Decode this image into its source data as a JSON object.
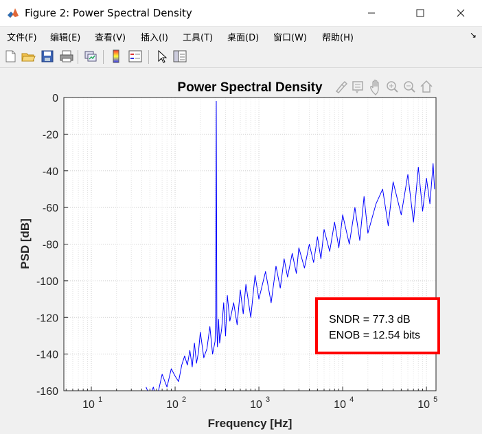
{
  "window": {
    "title": "Figure 2: Power Spectral Density"
  },
  "menu": {
    "items": [
      "文件(F)",
      "编辑(E)",
      "查看(V)",
      "插入(I)",
      "工具(T)",
      "桌面(D)",
      "窗口(W)",
      "帮助(H)"
    ]
  },
  "toolbar": {
    "icons": [
      "new-figure-icon",
      "open-file-icon",
      "save-icon",
      "print-icon",
      "link-plot-icon",
      "colorbar-icon",
      "legend-icon",
      "pointer-icon",
      "property-editor-icon"
    ]
  },
  "axes_toolbar": {
    "icons": [
      "brush-icon",
      "data-tips-icon",
      "pan-icon",
      "zoom-in-icon",
      "zoom-out-icon",
      "home-icon"
    ]
  },
  "colors": {
    "line": "#0000ff",
    "annotation_border": "#ff0000"
  },
  "chart_data": {
    "type": "line",
    "title": "Power Spectral Density",
    "xlabel": "Frequency [Hz]",
    "ylabel": "PSD [dB]",
    "xscale": "log",
    "xlim": [
      4.7,
      130000
    ],
    "ylim": [
      -160,
      0
    ],
    "xticks": [
      10,
      100,
      1000,
      10000,
      100000
    ],
    "xtick_labels": [
      {
        "base": "10",
        "exp": "1"
      },
      {
        "base": "10",
        "exp": "2"
      },
      {
        "base": "10",
        "exp": "3"
      },
      {
        "base": "10",
        "exp": "4"
      },
      {
        "base": "10",
        "exp": "5"
      }
    ],
    "yticks": [
      0,
      -20,
      -40,
      -60,
      -80,
      -100,
      -120,
      -140,
      -160
    ],
    "ytick_labels": [
      "0",
      "-20",
      "-40",
      "-60",
      "-80",
      "-100",
      "-120",
      "-140",
      "-160"
    ],
    "grid": true,
    "series": [
      {
        "x": [
          45,
          50,
          55,
          60,
          70,
          80,
          90,
          100,
          110,
          120,
          130,
          140,
          150,
          160,
          170,
          180,
          190,
          200,
          220,
          240,
          260,
          280,
          300,
          305,
          310,
          315,
          320,
          325,
          330,
          340,
          360,
          380,
          400,
          420,
          450,
          500,
          550,
          600,
          650,
          700,
          800,
          900,
          1000,
          1200,
          1400,
          1600,
          1800,
          2000,
          2200,
          2500,
          2800,
          3000,
          3500,
          4000,
          4500,
          5000,
          5500,
          6000,
          7000,
          8000,
          9000,
          10000,
          12000,
          14000,
          16000,
          18000,
          20000,
          25000,
          30000,
          35000,
          40000,
          50000,
          60000,
          70000,
          80000,
          90000,
          100000,
          110000,
          120000,
          125000
        ],
        "y": [
          -158,
          -163,
          -158,
          -165,
          -151,
          -158,
          -148,
          -152,
          -155,
          -146,
          -141,
          -146,
          -138,
          -147,
          -134,
          -145,
          -139,
          -128,
          -142,
          -137,
          -125,
          -140,
          -133,
          -118,
          -2,
          -125,
          -136,
          -130,
          -121,
          -134,
          -126,
          -112,
          -130,
          -108,
          -122,
          -112,
          -124,
          -105,
          -118,
          -102,
          -120,
          -97,
          -110,
          -95,
          -112,
          -92,
          -104,
          -88,
          -98,
          -85,
          -96,
          -82,
          -93,
          -80,
          -90,
          -76,
          -88,
          -72,
          -84,
          -68,
          -82,
          -64,
          -80,
          -60,
          -78,
          -54,
          -74,
          -58,
          -50,
          -70,
          -46,
          -64,
          -42,
          -68,
          -38,
          -62,
          -44,
          -58,
          -36,
          -50
        ]
      }
    ],
    "annotation": {
      "lines": [
        "SNDR = 77.3 dB",
        "ENOB = 12.54 bits"
      ]
    }
  }
}
